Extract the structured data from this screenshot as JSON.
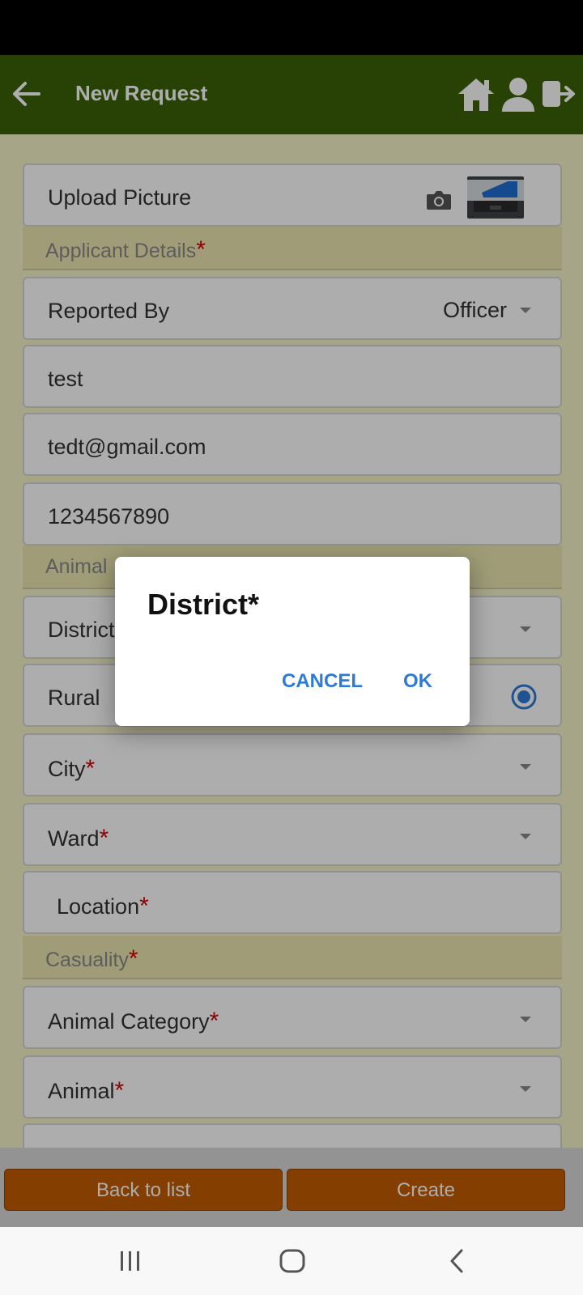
{
  "app_bar": {
    "title": "New Request",
    "icons": [
      "back-arrow-icon",
      "home-icon",
      "user-icon",
      "logout-icon"
    ]
  },
  "form": {
    "upload_picture_label": "Upload Picture",
    "applicant_section": "Applicant Details",
    "reported_by_label": "Reported By",
    "reported_by_value": "Officer",
    "name_value": "test",
    "email_value": "tedt@gmail.com",
    "phone_value": "1234567890",
    "animal_section_partial": "Animal",
    "district_label_partial": "District",
    "rural_label": "Rural",
    "city_label": "City",
    "ward_label": "Ward",
    "location_label": "Location",
    "casuality_section": "Casuality",
    "animal_category_label": "Animal Category",
    "animal_label": "Animal",
    "required_mark": "*"
  },
  "buttons": {
    "back_to_list": "Back to list",
    "create": "Create"
  },
  "dialog": {
    "title": "District*",
    "cancel": "CANCEL",
    "ok": "OK"
  },
  "colors": {
    "app_bar": "#3b6108",
    "content_bg": "#f7f3c7",
    "button": "#c35c00",
    "accent": "#2e7bd7",
    "required": "#d40000"
  }
}
